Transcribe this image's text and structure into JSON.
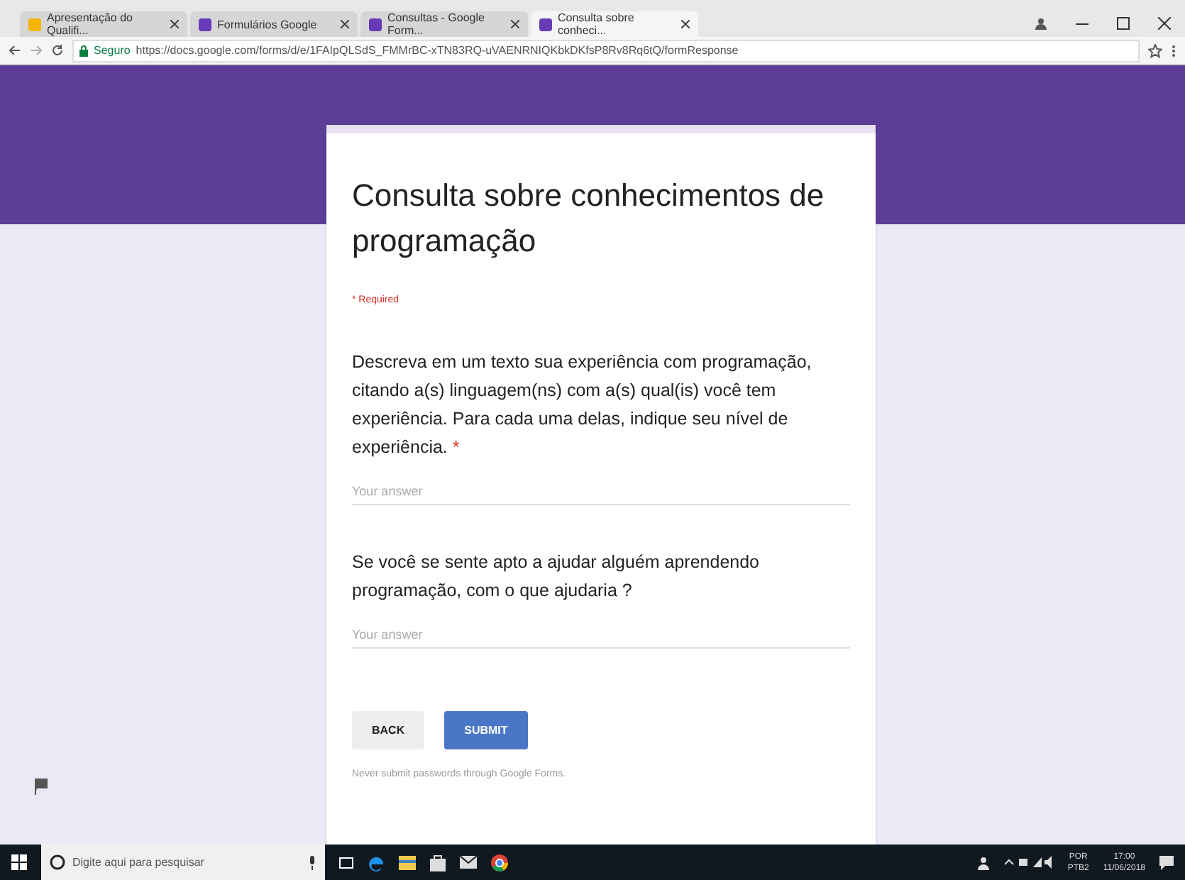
{
  "browser": {
    "tabs": [
      {
        "label": "Apresentação do Qualifi...",
        "selected": false,
        "color": "#f4b400"
      },
      {
        "label": "Formulários Google",
        "selected": false,
        "color": "#673ab7"
      },
      {
        "label": "Consultas - Google Form...",
        "selected": false,
        "color": "#673ab7"
      },
      {
        "label": "Consulta sobre conheci...",
        "selected": true,
        "color": "#673ab7"
      }
    ],
    "security": "Seguro",
    "url": "https://docs.google.com/forms/d/e/1FAIpQLSdS_FMMrBC-xTN83RQ-uVAENRNIQKbkDKfsP8Rv8Rq6tQ/formResponse"
  },
  "form": {
    "title": "Consulta sobre conhecimentos de programação",
    "required_note": "* Required",
    "required_mark": "*",
    "questions": [
      {
        "text": "Descreva em um texto sua experiência com programação, citando a(s) linguagem(ns) com a(s) qual(is) você tem experiência. Para cada uma delas, indique seu nível de experiência.",
        "required": true,
        "placeholder": "Your answer"
      },
      {
        "text": "Se você se sente apto a ajudar alguém aprendendo programação, com o que ajudaria ?",
        "required": false,
        "placeholder": "Your answer"
      }
    ],
    "buttons": [
      {
        "label": "BACK",
        "kind": "flat"
      },
      {
        "label": "SUBMIT",
        "kind": "raised"
      }
    ],
    "footer": "Never submit passwords through Google Forms."
  },
  "taskbar": {
    "search_placeholder": "Digite aqui para pesquisar",
    "language": "POR",
    "layout": "PTB2",
    "time": "17:00",
    "date": "11/06/2018"
  }
}
